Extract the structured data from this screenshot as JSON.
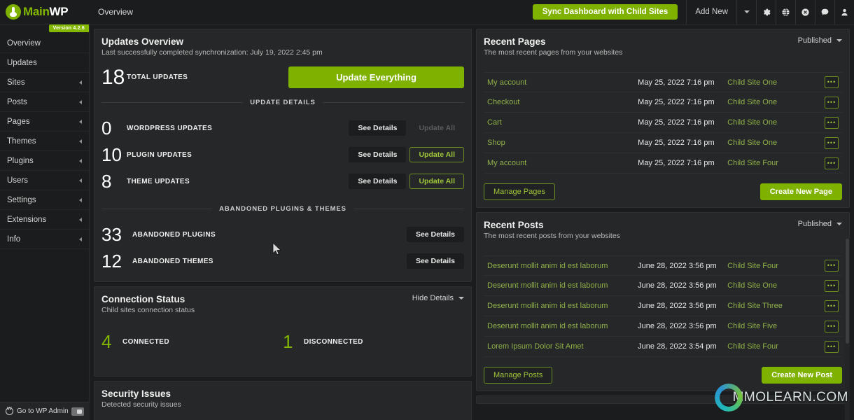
{
  "app": {
    "brand_main": "Main",
    "brand_wp": "WP",
    "brand_logo_icon": "mainwp-plug-logo",
    "version_badge": "Version 4.2.6",
    "page_title": "Overview"
  },
  "header": {
    "sync_button": "Sync Dashboard with Child Sites",
    "add_new": "Add New",
    "dropdown_icon": "chevron-down-icon",
    "icons": [
      {
        "name": "gear-icon",
        "glyph": "⚙"
      },
      {
        "name": "globe-icon",
        "glyph": "ἱ0"
      },
      {
        "name": "close-circle-icon",
        "glyph": "⊗"
      },
      {
        "name": "comment-icon",
        "glyph": "●"
      },
      {
        "name": "user-icon",
        "glyph": "●"
      }
    ]
  },
  "sidebar": {
    "items": [
      {
        "label": "Overview",
        "has_arrow": false
      },
      {
        "label": "Updates",
        "has_arrow": false
      },
      {
        "label": "Sites",
        "has_arrow": true
      },
      {
        "label": "Posts",
        "has_arrow": true
      },
      {
        "label": "Pages",
        "has_arrow": true
      },
      {
        "label": "Themes",
        "has_arrow": true
      },
      {
        "label": "Plugins",
        "has_arrow": true
      },
      {
        "label": "Users",
        "has_arrow": true
      },
      {
        "label": "Settings",
        "has_arrow": true
      },
      {
        "label": "Extensions",
        "has_arrow": true
      },
      {
        "label": "Info",
        "has_arrow": true
      }
    ],
    "wp_admin": {
      "label": "Go to WP Admin",
      "icon": "wordpress-icon",
      "toggle_icon": "external-link-icon"
    }
  },
  "updates_overview": {
    "title": "Updates Overview",
    "subtitle": "Last successfully completed synchronization: July 19, 2022 2:45 pm",
    "total_count": "18",
    "total_label": "TOTAL UPDATES",
    "update_everything_button": "Update Everything",
    "details_divider": "UPDATE DETAILS",
    "rows": [
      {
        "count": "0",
        "label": "WORDPRESS UPDATES",
        "see_details": "See Details",
        "update_all": "Update All",
        "update_all_enabled": false
      },
      {
        "count": "10",
        "label": "PLUGIN UPDATES",
        "see_details": "See Details",
        "update_all": "Update All",
        "update_all_enabled": true
      },
      {
        "count": "8",
        "label": "THEME UPDATES",
        "see_details": "See Details",
        "update_all": "Update All",
        "update_all_enabled": true
      }
    ],
    "abandoned_divider": "ABANDONED PLUGINS & THEMES",
    "abandoned_rows": [
      {
        "count": "33",
        "label": "ABANDONED PLUGINS",
        "see_details": "See Details"
      },
      {
        "count": "12",
        "label": "ABANDONED THEMES",
        "see_details": "See Details"
      }
    ]
  },
  "connection_status": {
    "title": "Connection Status",
    "subtitle": "Child sites connection status",
    "toggle_label": "Hide Details",
    "toggle_icon": "chevron-down-icon",
    "connected_count": "4",
    "connected_label": "CONNECTED",
    "disconnected_count": "1",
    "disconnected_label": "DISCONNECTED"
  },
  "security_issues": {
    "title": "Security Issues",
    "subtitle": "Detected security issues"
  },
  "recent_pages": {
    "title": "Recent Pages",
    "subtitle": "The most recent pages from your websites",
    "filter_label": "Published",
    "filter_icon": "chevron-down-icon",
    "rows": [
      {
        "title": "My account",
        "date": "May 25, 2022 7:16 pm",
        "site": "Child Site One",
        "actions": "•••"
      },
      {
        "title": "Checkout",
        "date": "May 25, 2022 7:16 pm",
        "site": "Child Site One",
        "actions": "•••"
      },
      {
        "title": "Cart",
        "date": "May 25, 2022 7:16 pm",
        "site": "Child Site One",
        "actions": "•••"
      },
      {
        "title": "Shop",
        "date": "May 25, 2022 7:16 pm",
        "site": "Child Site One",
        "actions": "•••"
      },
      {
        "title": "My account",
        "date": "May 25, 2022 7:16 pm",
        "site": "Child Site Four",
        "actions": "•••"
      }
    ],
    "manage_button": "Manage Pages",
    "create_button": "Create New Page"
  },
  "recent_posts": {
    "title": "Recent Posts",
    "subtitle": "The most recent posts from your websites",
    "filter_label": "Published",
    "filter_icon": "chevron-down-icon",
    "rows": [
      {
        "title": "Deserunt mollit anim id est laborum",
        "date": "June 28, 2022 3:56 pm",
        "site": "Child Site Four",
        "actions": "•••"
      },
      {
        "title": "Deserunt mollit anim id est laborum",
        "date": "June 28, 2022 3:56 pm",
        "site": "Child Site One",
        "actions": "•••"
      },
      {
        "title": "Deserunt mollit anim id est laborum",
        "date": "June 28, 2022 3:56 pm",
        "site": "Child Site Three",
        "actions": "•••"
      },
      {
        "title": "Deserunt mollit anim id est laborum",
        "date": "June 28, 2022 3:56 pm",
        "site": "Child Site Five",
        "actions": "•••"
      },
      {
        "title": "Lorem Ipsum Dolor Sit Amet",
        "date": "June 28, 2022 3:54 pm",
        "site": "Child Site Four",
        "actions": "•••"
      }
    ],
    "manage_button": "Manage Posts",
    "create_button": "Create New Post"
  },
  "watermark": {
    "text": "MMOLEARN.COM",
    "icon": "mmolearn-swirl-logo"
  },
  "colors": {
    "accent_green": "#7fb100",
    "link_green": "#8fb14a",
    "panel_bg": "#262728",
    "page_bg": "#1b1c1d"
  }
}
